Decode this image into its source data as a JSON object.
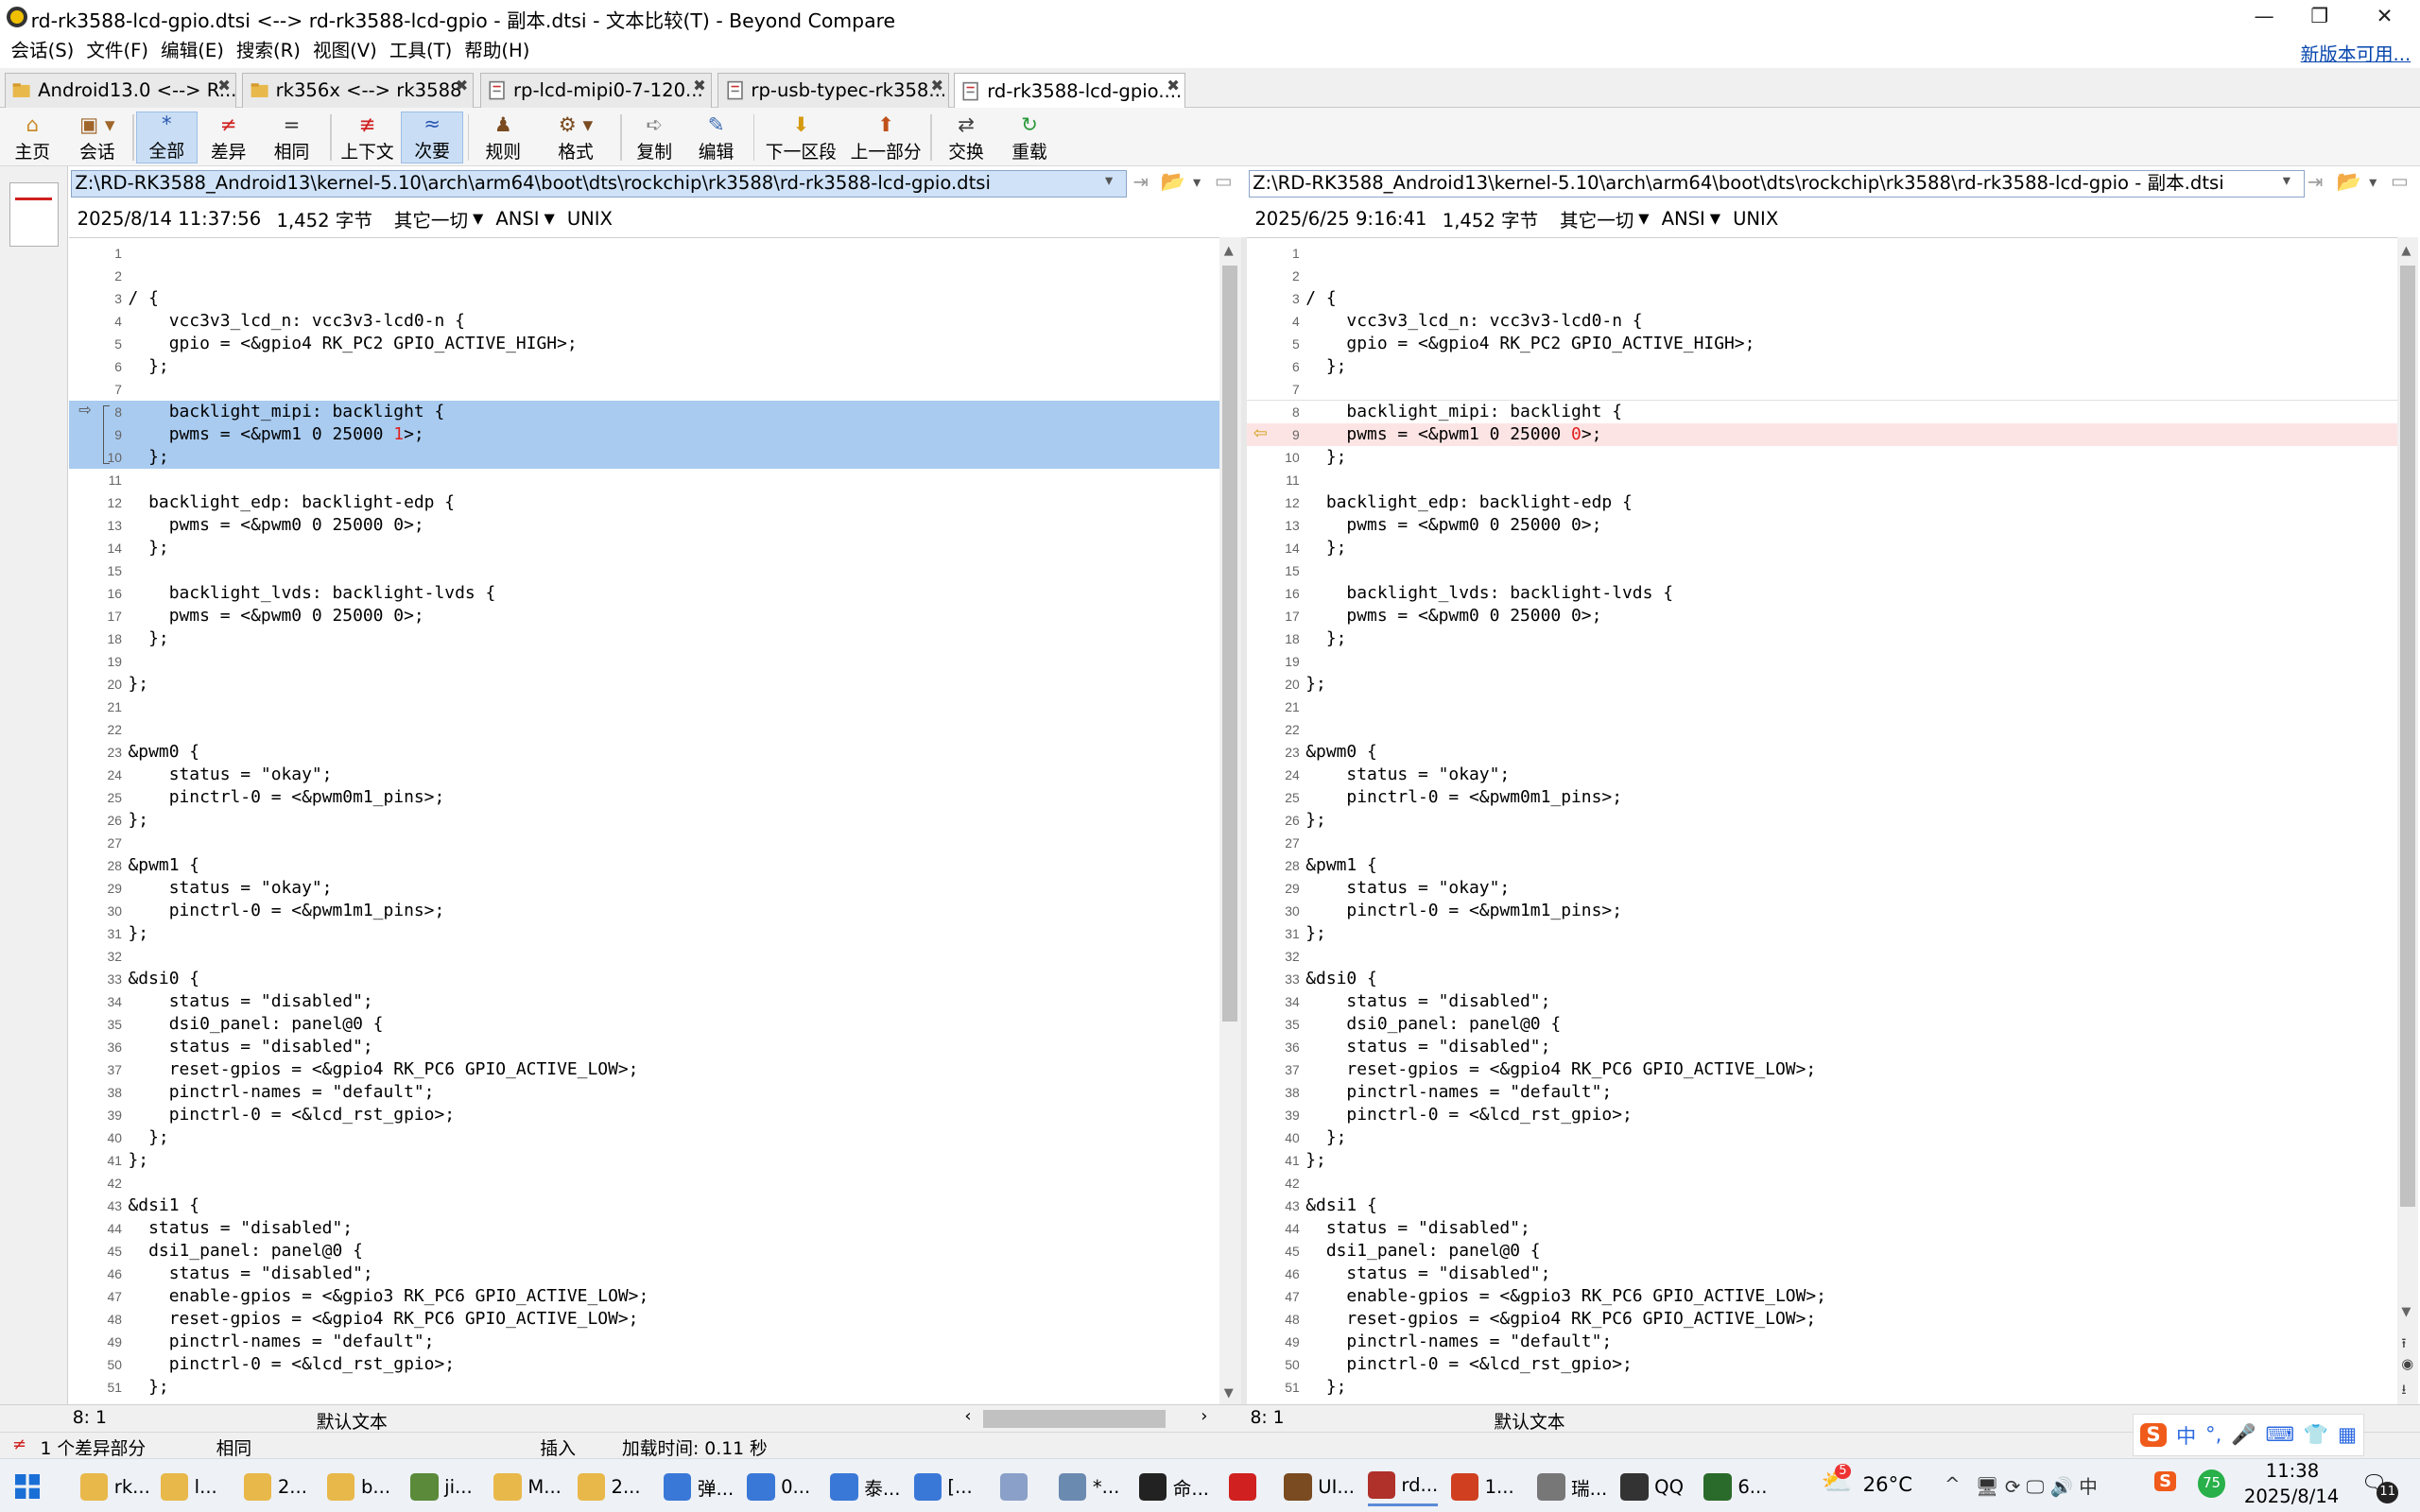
{
  "window": {
    "title": "rd-rk3588-lcd-gpio.dtsi <--> rd-rk3588-lcd-gpio - 副本.dtsi - 文本比较(T) - Beyond Compare",
    "minimize": "—",
    "maximize": "❐",
    "close": "✕"
  },
  "menu": {
    "items": [
      "会话(S)",
      "文件(F)",
      "编辑(E)",
      "搜索(R)",
      "视图(V)",
      "工具(T)",
      "帮助(H)"
    ],
    "update_link": "新版本可用..."
  },
  "tabs": [
    {
      "label": "Android13.0 <--> R..."
    },
    {
      "label": "rk356x <--> rk3588"
    },
    {
      "label": "rp-lcd-mipi0-7-120..."
    },
    {
      "label": "rp-usb-typec-rk358..."
    },
    {
      "label": "rd-rk3588-lcd-gpio...."
    }
  ],
  "toolbar": {
    "home": "主页",
    "session": "会话",
    "all": "全部",
    "diffs": "差异",
    "same": "相同",
    "context": "上下文",
    "minor": "次要",
    "rules": "规则",
    "format": "格式",
    "copy": "复制",
    "edit": "编辑",
    "next_section": "下一区段",
    "prev_section": "上一部分",
    "swap": "交换",
    "reload": "重载"
  },
  "left": {
    "path": "Z:\\RD-RK3588_Android13\\kernel-5.10\\arch\\arm64\\boot\\dts\\rockchip\\rk3588\\rd-rk3588-lcd-gpio.dtsi",
    "date": "2025/8/14 11:37:56",
    "size": "1,452 字节",
    "other": "其它一切",
    "encoding": "ANSI",
    "eol": "UNIX",
    "cursor": "8: 1",
    "textmode": "默认文本"
  },
  "right": {
    "path": "Z:\\RD-RK3588_Android13\\kernel-5.10\\arch\\arm64\\boot\\dts\\rockchip\\rk3588\\rd-rk3588-lcd-gpio - 副本.dtsi",
    "date": "2025/6/25 9:16:41",
    "size": "1,452 字节",
    "other": "其它一切",
    "encoding": "ANSI",
    "eol": "UNIX",
    "cursor": "8: 1",
    "textmode": "默认文本"
  },
  "left_lines": [
    "",
    "",
    "/ {",
    "    vcc3v3_lcd_n: vcc3v3-lcd0-n {",
    "    gpio = <&gpio4 RK_PC2 GPIO_ACTIVE_HIGH>;",
    "  };",
    "",
    "    backlight_mipi: backlight {",
    "    pwms = <&pwm1 0 25000 1>;",
    "  };",
    "",
    "  backlight_edp: backlight-edp {",
    "    pwms = <&pwm0 0 25000 0>;",
    "  };",
    "",
    "    backlight_lvds: backlight-lvds {",
    "    pwms = <&pwm0 0 25000 0>;",
    "  };",
    "",
    "};",
    "",
    "",
    "&pwm0 {",
    "    status = \"okay\";",
    "    pinctrl-0 = <&pwm0m1_pins>;",
    "};",
    "",
    "&pwm1 {",
    "    status = \"okay\";",
    "    pinctrl-0 = <&pwm1m1_pins>;",
    "};",
    "",
    "&dsi0 {",
    "    status = \"disabled\";",
    "    dsi0_panel: panel@0 {",
    "    status = \"disabled\";",
    "    reset-gpios = <&gpio4 RK_PC6 GPIO_ACTIVE_LOW>;",
    "    pinctrl-names = \"default\";",
    "    pinctrl-0 = <&lcd_rst_gpio>;",
    "  };",
    "};",
    "",
    "&dsi1 {",
    "  status = \"disabled\";",
    "  dsi1_panel: panel@0 {",
    "    status = \"disabled\";",
    "    enable-gpios = <&gpio3 RK_PC6 GPIO_ACTIVE_LOW>;",
    "    reset-gpios = <&gpio4 RK_PC6 GPIO_ACTIVE_LOW>;",
    "    pinctrl-names = \"default\";",
    "    pinctrl-0 = <&lcd_rst_gpio>;",
    "  };"
  ],
  "right_lines": [
    "",
    "",
    "/ {",
    "    vcc3v3_lcd_n: vcc3v3-lcd0-n {",
    "    gpio = <&gpio4 RK_PC2 GPIO_ACTIVE_HIGH>;",
    "  };",
    "",
    "    backlight_mipi: backlight {",
    "    pwms = <&pwm1 0 25000 0>;",
    "  };",
    "",
    "  backlight_edp: backlight-edp {",
    "    pwms = <&pwm0 0 25000 0>;",
    "  };",
    "",
    "    backlight_lvds: backlight-lvds {",
    "    pwms = <&pwm0 0 25000 0>;",
    "  };",
    "",
    "};",
    "",
    "",
    "&pwm0 {",
    "    status = \"okay\";",
    "    pinctrl-0 = <&pwm0m1_pins>;",
    "};",
    "",
    "&pwm1 {",
    "    status = \"okay\";",
    "    pinctrl-0 = <&pwm1m1_pins>;",
    "};",
    "",
    "&dsi0 {",
    "    status = \"disabled\";",
    "    dsi0_panel: panel@0 {",
    "    status = \"disabled\";",
    "    reset-gpios = <&gpio4 RK_PC6 GPIO_ACTIVE_LOW>;",
    "    pinctrl-names = \"default\";",
    "    pinctrl-0 = <&lcd_rst_gpio>;",
    "  };",
    "};",
    "",
    "&dsi1 {",
    "  status = \"disabled\";",
    "  dsi1_panel: panel@0 {",
    "    status = \"disabled\";",
    "    enable-gpios = <&gpio3 RK_PC6 GPIO_ACTIVE_LOW>;",
    "    reset-gpios = <&gpio4 RK_PC6 GPIO_ACTIVE_LOW>;",
    "    pinctrl-names = \"default\";",
    "    pinctrl-0 = <&lcd_rst_gpio>;",
    "  };"
  ],
  "diff": {
    "selected_lines": [
      8,
      9,
      10
    ],
    "changed_line": 9,
    "left_changed_char": "1",
    "right_changed_char": "0",
    "colors": {
      "selection": "#a9cbf0",
      "diff_bg": "#fde4e4",
      "diff_text": "#e02020",
      "arrow": "#d4a017"
    }
  },
  "status": {
    "diff_count": "1 个差异部分",
    "same": "相同",
    "insert": "插入",
    "load_time": "加载时间: 0.11 秒"
  },
  "taskbar": {
    "items": [
      "rk...",
      "l...",
      "2...",
      "b...",
      "ji...",
      "M...",
      "2...",
      "弹...",
      "0...",
      "泰...",
      "[...",
      "",
      "*...",
      "命...",
      "",
      "UI...",
      "rd...",
      "1...",
      "瑞...",
      "QQ",
      "6..."
    ],
    "weather": "26°C",
    "time": "11:38",
    "date": "2025/8/14",
    "badge": "5",
    "notify": "11",
    "ime": "中",
    "score": "75"
  }
}
